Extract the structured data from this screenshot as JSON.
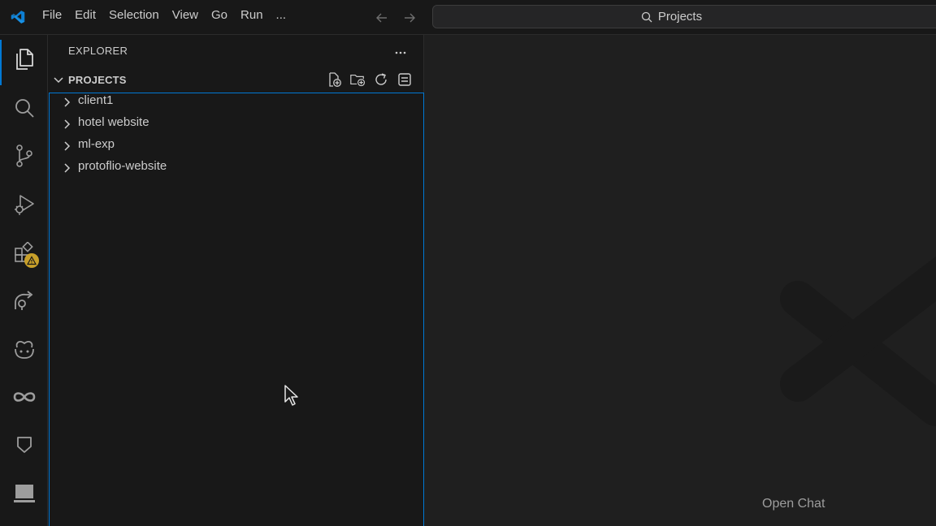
{
  "titlebar": {
    "logo_icon": "vscode-logo-icon",
    "menu": [
      "File",
      "Edit",
      "Selection",
      "View",
      "Go",
      "Run",
      "..."
    ],
    "command_center": {
      "label": "Projects",
      "icon": "search-icon"
    }
  },
  "activitybar": {
    "items": [
      {
        "name": "explorer",
        "icon": "files-icon",
        "active": true
      },
      {
        "name": "search",
        "icon": "search-icon"
      },
      {
        "name": "source-control",
        "icon": "source-control-icon"
      },
      {
        "name": "run-and-debug",
        "icon": "run-debug-icon"
      },
      {
        "name": "extensions",
        "icon": "extensions-icon",
        "badge": "warning"
      },
      {
        "name": "remote-explorer",
        "icon": "remote-icon"
      },
      {
        "name": "copilot",
        "icon": "copilot-icon"
      },
      {
        "name": "live-share",
        "icon": "infinity-icon"
      },
      {
        "name": "testing",
        "icon": "shield-icon"
      },
      {
        "name": "panel",
        "icon": "laptop-icon"
      }
    ],
    "accent_color": "#0078d4",
    "badge_color": "#c8a02a"
  },
  "sidebar": {
    "title": "EXPLORER",
    "section": {
      "title": "PROJECTS",
      "actions": [
        "new-file-icon",
        "new-folder-icon",
        "refresh-icon",
        "collapse-all-icon"
      ]
    },
    "tree": [
      {
        "label": "client1"
      },
      {
        "label": "hotel website"
      },
      {
        "label": "ml-exp"
      },
      {
        "label": "protoflio-website"
      }
    ]
  },
  "editor": {
    "hint": "Open Chat"
  }
}
